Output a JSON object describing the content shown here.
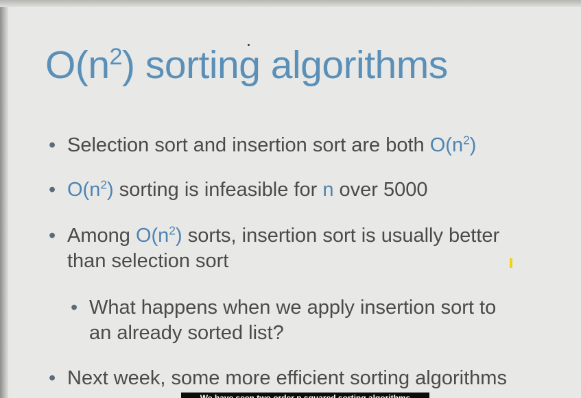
{
  "slide": {
    "title_pre": "O(n",
    "title_sup": "2",
    "title_post": ") sorting algorithms",
    "bullets": [
      {
        "parts": [
          "Selection sort and insertion sort are both ",
          "O(n",
          "2",
          ")"
        ]
      },
      {
        "parts": [
          "O(n",
          "2",
          ")",
          " sorting is infeasible for ",
          "n",
          " over 5000"
        ]
      },
      {
        "line1_parts": [
          "Among ",
          "O(n",
          "2",
          ")",
          " sorts, insertion sort is usually better"
        ],
        "line2": "than selection sort"
      },
      {
        "line1": "What happens when we apply insertion sort to",
        "line2": "an already sorted list?"
      },
      {
        "text": "Next week, some more efficient sorting algorithms"
      }
    ],
    "bullet_glyph": "•"
  },
  "caption": {
    "text": "We have seen two order n squared sorting algorithms"
  },
  "colors": {
    "title": "#5a8fb8",
    "highlight": "#4e84b3",
    "body_text": "#4a4a4a",
    "background": "#e8e8e6",
    "cursor": "#f2d40d"
  }
}
